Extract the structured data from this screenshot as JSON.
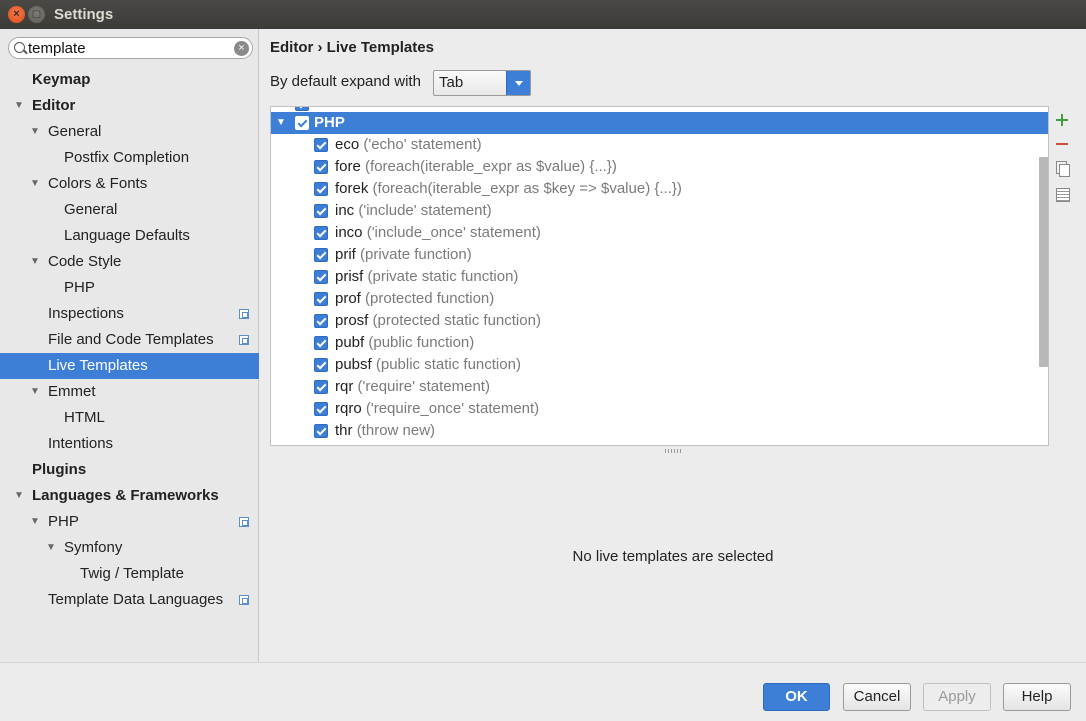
{
  "window": {
    "title": "Settings",
    "close_glyph": "×",
    "max_glyph": "▢"
  },
  "search": {
    "value": "template",
    "clear_glyph": "×"
  },
  "tree": [
    {
      "label": "Keymap",
      "level": 0,
      "bold": true,
      "expanded": null,
      "project": false,
      "selected": false
    },
    {
      "label": "Editor",
      "level": 0,
      "bold": true,
      "expanded": true,
      "project": false,
      "selected": false
    },
    {
      "label": "General",
      "level": 1,
      "bold": false,
      "expanded": true,
      "project": false,
      "selected": false
    },
    {
      "label": "Postfix Completion",
      "level": 2,
      "bold": false,
      "expanded": null,
      "project": false,
      "selected": false
    },
    {
      "label": "Colors & Fonts",
      "level": 1,
      "bold": false,
      "expanded": true,
      "project": false,
      "selected": false
    },
    {
      "label": "General",
      "level": 2,
      "bold": false,
      "expanded": null,
      "project": false,
      "selected": false
    },
    {
      "label": "Language Defaults",
      "level": 2,
      "bold": false,
      "expanded": null,
      "project": false,
      "selected": false
    },
    {
      "label": "Code Style",
      "level": 1,
      "bold": false,
      "expanded": true,
      "project": false,
      "selected": false
    },
    {
      "label": "PHP",
      "level": 2,
      "bold": false,
      "expanded": null,
      "project": false,
      "selected": false
    },
    {
      "label": "Inspections",
      "level": 1,
      "bold": false,
      "expanded": null,
      "project": true,
      "selected": false
    },
    {
      "label": "File and Code Templates",
      "level": 1,
      "bold": false,
      "expanded": null,
      "project": true,
      "selected": false
    },
    {
      "label": "Live Templates",
      "level": 1,
      "bold": false,
      "expanded": null,
      "project": false,
      "selected": true
    },
    {
      "label": "Emmet",
      "level": 1,
      "bold": false,
      "expanded": true,
      "project": false,
      "selected": false
    },
    {
      "label": "HTML",
      "level": 2,
      "bold": false,
      "expanded": null,
      "project": false,
      "selected": false
    },
    {
      "label": "Intentions",
      "level": 1,
      "bold": false,
      "expanded": null,
      "project": false,
      "selected": false
    },
    {
      "label": "Plugins",
      "level": 0,
      "bold": true,
      "expanded": null,
      "project": false,
      "selected": false
    },
    {
      "label": "Languages & Frameworks",
      "level": 0,
      "bold": true,
      "expanded": true,
      "project": false,
      "selected": false
    },
    {
      "label": "PHP",
      "level": 1,
      "bold": false,
      "expanded": true,
      "project": true,
      "selected": false
    },
    {
      "label": "Symfony",
      "level": 2,
      "bold": false,
      "expanded": true,
      "project": false,
      "selected": false
    },
    {
      "label": "Twig / Template",
      "level": 3,
      "bold": false,
      "expanded": null,
      "project": false,
      "selected": false
    },
    {
      "label": "Template Data Languages",
      "level": 1,
      "bold": false,
      "expanded": null,
      "project": true,
      "selected": false
    }
  ],
  "main": {
    "breadcrumb": "Editor › Live Templates",
    "expand_label": "By default expand with",
    "expand_value": "Tab",
    "group": {
      "label": "PHP",
      "checked": true
    },
    "templates": [
      {
        "abbr": "eco",
        "desc": "('echo' statement)"
      },
      {
        "abbr": "fore",
        "desc": "(foreach(iterable_expr as $value) {...})"
      },
      {
        "abbr": "forek",
        "desc": "(foreach(iterable_expr as $key => $value) {...})"
      },
      {
        "abbr": "inc",
        "desc": "('include' statement)"
      },
      {
        "abbr": "inco",
        "desc": "('include_once' statement)"
      },
      {
        "abbr": "prif",
        "desc": "(private function)"
      },
      {
        "abbr": "prisf",
        "desc": "(private static function)"
      },
      {
        "abbr": "prof",
        "desc": "(protected function)"
      },
      {
        "abbr": "prosf",
        "desc": "(protected static function)"
      },
      {
        "abbr": "pubf",
        "desc": "(public function)"
      },
      {
        "abbr": "pubsf",
        "desc": "(public static function)"
      },
      {
        "abbr": "rqr",
        "desc": "('require' statement)"
      },
      {
        "abbr": "rqro",
        "desc": "('require_once' statement)"
      },
      {
        "abbr": "thr",
        "desc": "(throw new)"
      }
    ],
    "empty_message": "No live templates are selected"
  },
  "buttons": {
    "ok": "OK",
    "cancel": "Cancel",
    "apply": "Apply",
    "help": "Help"
  },
  "colors": {
    "accent": "#3d7fd6",
    "add": "#3f9f3f",
    "remove": "#c94f3f"
  }
}
